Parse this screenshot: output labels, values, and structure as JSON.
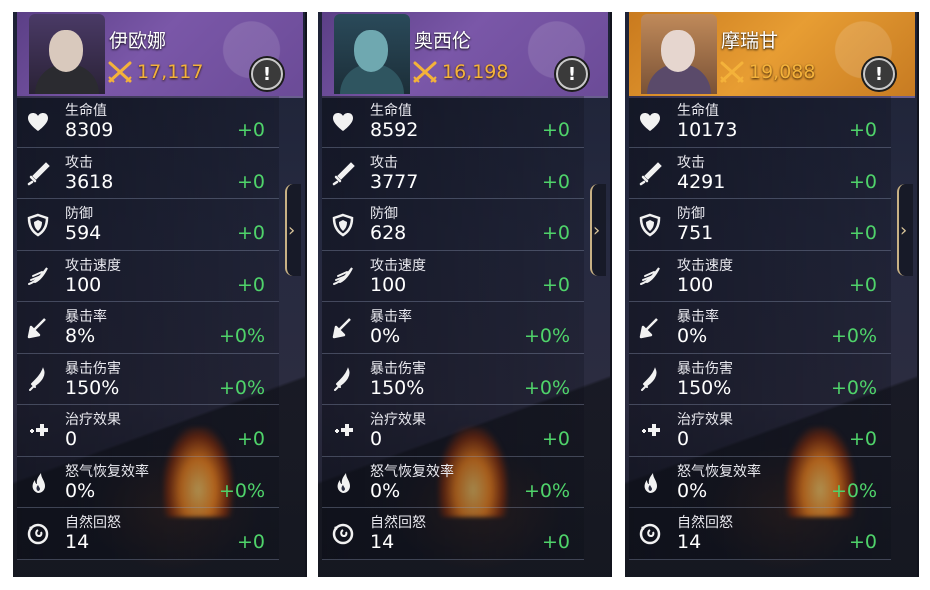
{
  "colors": {
    "bonus": "#4fd36a",
    "power": "#f4b23a",
    "purple_header": "#6b4b97",
    "orange_header": "#e79d33"
  },
  "icons": [
    "heart-icon",
    "sword-icon",
    "shield-icon",
    "wing-icon",
    "crit-arrow-icon",
    "blade-icon",
    "heal-plus-icon",
    "rage-flame-icon",
    "regen-swirl-icon",
    "alert-icon",
    "crossed-swords-icon",
    "chevron-right-icon"
  ],
  "heroes": [
    {
      "name": "伊欧娜",
      "power": "17,117",
      "header_theme": "purple",
      "alert": "!",
      "stats": [
        {
          "label": "生命值",
          "value": "8309",
          "bonus": "+0"
        },
        {
          "label": "攻击",
          "value": "3618",
          "bonus": "+0"
        },
        {
          "label": "防御",
          "value": "594",
          "bonus": "+0"
        },
        {
          "label": "攻击速度",
          "value": "100",
          "bonus": "+0"
        },
        {
          "label": "暴击率",
          "value": "8%",
          "bonus": "+0%"
        },
        {
          "label": "暴击伤害",
          "value": "150%",
          "bonus": "+0%"
        },
        {
          "label": "治疗效果",
          "value": "0",
          "bonus": "+0"
        },
        {
          "label": "怒气恢复效率",
          "value": "0%",
          "bonus": "+0%"
        },
        {
          "label": "自然回怒",
          "value": "14",
          "bonus": "+0"
        }
      ]
    },
    {
      "name": "奥西伦",
      "power": "16,198",
      "header_theme": "purple",
      "alert": "!",
      "stats": [
        {
          "label": "生命值",
          "value": "8592",
          "bonus": "+0"
        },
        {
          "label": "攻击",
          "value": "3777",
          "bonus": "+0"
        },
        {
          "label": "防御",
          "value": "628",
          "bonus": "+0"
        },
        {
          "label": "攻击速度",
          "value": "100",
          "bonus": "+0"
        },
        {
          "label": "暴击率",
          "value": "0%",
          "bonus": "+0%"
        },
        {
          "label": "暴击伤害",
          "value": "150%",
          "bonus": "+0%"
        },
        {
          "label": "治疗效果",
          "value": "0",
          "bonus": "+0"
        },
        {
          "label": "怒气恢复效率",
          "value": "0%",
          "bonus": "+0%"
        },
        {
          "label": "自然回怒",
          "value": "14",
          "bonus": "+0"
        }
      ]
    },
    {
      "name": "摩瑞甘",
      "power": "19,088",
      "header_theme": "orange",
      "alert": "!",
      "stats": [
        {
          "label": "生命值",
          "value": "10173",
          "bonus": "+0"
        },
        {
          "label": "攻击",
          "value": "4291",
          "bonus": "+0"
        },
        {
          "label": "防御",
          "value": "751",
          "bonus": "+0"
        },
        {
          "label": "攻击速度",
          "value": "100",
          "bonus": "+0"
        },
        {
          "label": "暴击率",
          "value": "0%",
          "bonus": "+0%"
        },
        {
          "label": "暴击伤害",
          "value": "150%",
          "bonus": "+0%"
        },
        {
          "label": "治疗效果",
          "value": "0",
          "bonus": "+0"
        },
        {
          "label": "怒气恢复效率",
          "value": "0%",
          "bonus": "+0%"
        },
        {
          "label": "自然回怒",
          "value": "14",
          "bonus": "+0"
        }
      ]
    }
  ]
}
